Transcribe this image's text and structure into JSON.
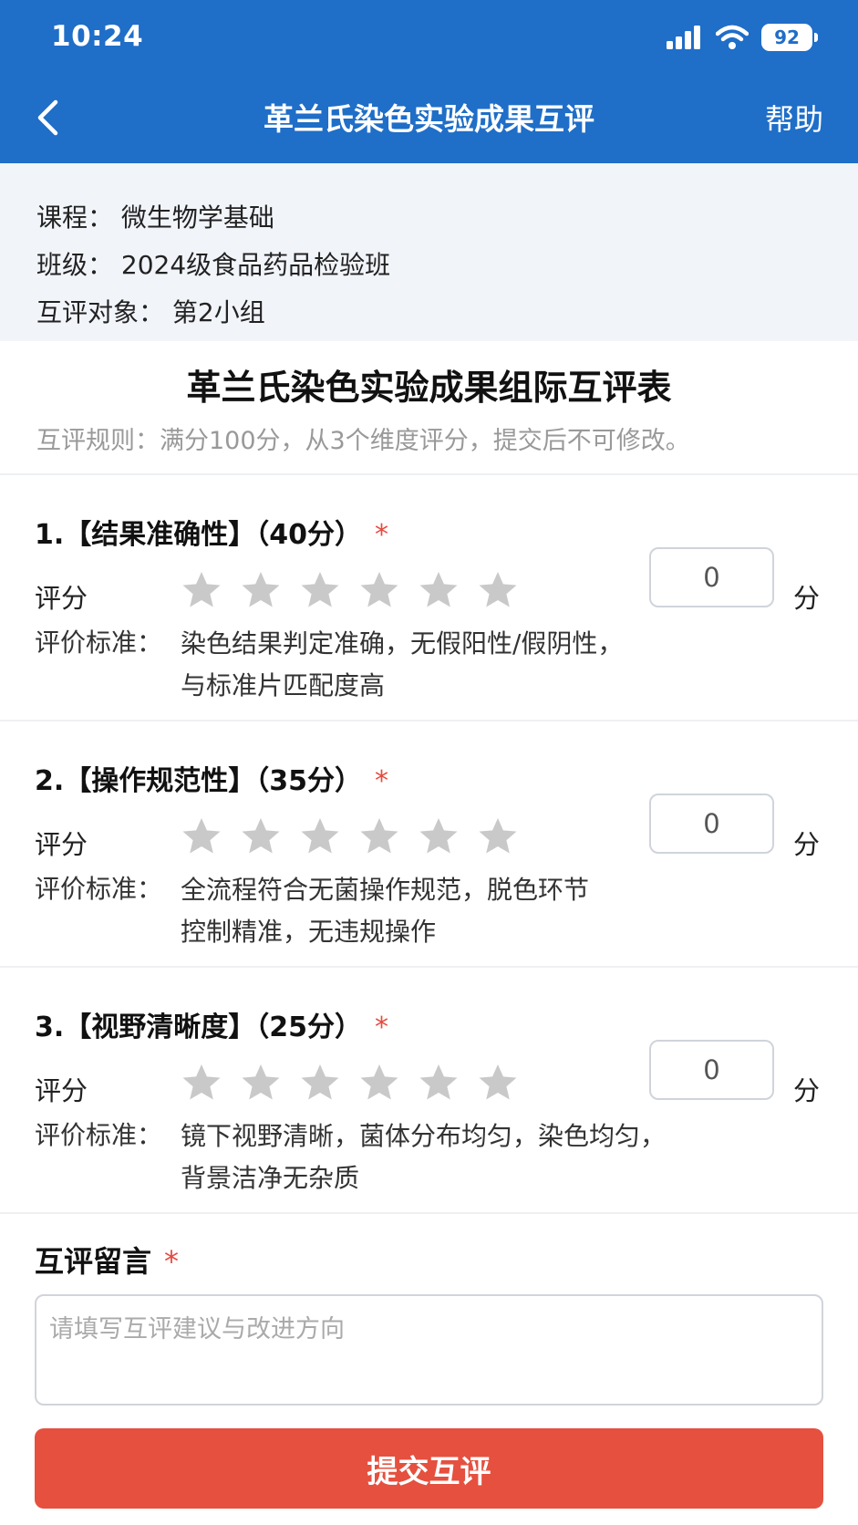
{
  "status_bar": {
    "time": "10:24",
    "battery": "92"
  },
  "header": {
    "title": "革兰氏染色实验成果互评",
    "help": "帮助"
  },
  "info": {
    "course": "课程：  微生物学基础",
    "class": "班级：  2024级食品药品检验班",
    "target": "互评对象：  第2小组"
  },
  "form": {
    "title": "革兰氏染色实验成果组际互评表",
    "rules": "互评规则：满分100分，从3个维度评分，提交后不可修改。"
  },
  "criteria": [
    {
      "title": "1.【结果准确性】（40分）",
      "required": "*",
      "score_label": "评分",
      "score_value": "0",
      "unit": "分",
      "criteria_label": "评价标准：",
      "criteria_line1": "染色结果判定准确，无假阳性/假阴性，",
      "criteria_line2": "与标准片匹配度高",
      "stars_filled": 0,
      "stars_total": 6
    },
    {
      "title": "2.【操作规范性】（35分）",
      "required": "*",
      "score_label": "评分",
      "score_value": "0",
      "unit": "分",
      "criteria_label": "评价标准：",
      "criteria_line1": "全流程符合无菌操作规范，脱色环节",
      "criteria_line2": "控制精准，无违规操作",
      "stars_filled": 0,
      "stars_total": 6
    },
    {
      "title": "3.【视野清晰度】（25分）",
      "required": "*",
      "score_label": "评分",
      "score_value": "0",
      "unit": "分",
      "criteria_label": "评价标准：",
      "criteria_line1": "镜下视野清晰，菌体分布均匀，染色均匀，",
      "criteria_line2": "背景洁净无杂质",
      "stars_filled": 0,
      "stars_total": 6
    }
  ],
  "comment": {
    "label": "互评留言",
    "required": "*",
    "placeholder": "请填写互评建议与改进方向",
    "value": ""
  },
  "submit": {
    "label": "提交互评"
  },
  "colors": {
    "primary": "#1f6ec8",
    "submit": "#e5503f",
    "required": "#e54b3f",
    "star_empty": "#c9c9c9"
  },
  "icons": {
    "back": "chevron-left-icon",
    "signal": "signal-icon",
    "wifi": "wifi-icon",
    "battery": "battery-icon",
    "star": "star-icon"
  }
}
